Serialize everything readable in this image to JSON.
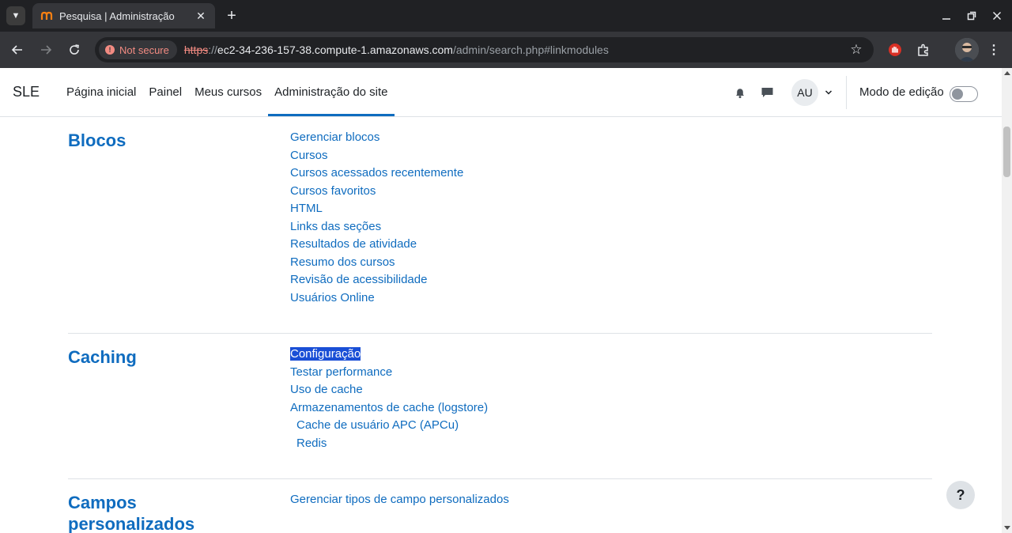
{
  "browser": {
    "tab_title": "Pesquisa | Administração",
    "security_label": "Not secure",
    "url_scheme": "https",
    "url_sep": "://",
    "url_host": "ec2-34-236-157-38.compute-1.amazonaws.com",
    "url_path": "/admin/search.php#linkmodules"
  },
  "navbar": {
    "brand": "SLE",
    "items": [
      "Página inicial",
      "Painel",
      "Meus cursos",
      "Administração do site"
    ],
    "active_item": "Administração do site",
    "avatar_initials": "AU",
    "edit_mode_label": "Modo de edição",
    "edit_mode_on": false
  },
  "sections": [
    {
      "title": "Blocos",
      "links": [
        "Gerenciar blocos",
        "Cursos",
        "Cursos acessados recentemente",
        "Cursos favoritos",
        "HTML",
        "Links das seções",
        "Resultados de atividade",
        "Resumo dos cursos",
        "Revisão de acessibilidade",
        "Usuários Online"
      ]
    },
    {
      "title": "Caching",
      "links": [
        "Configuração",
        "Testar performance",
        "Uso de cache",
        "Armazenamentos de cache (logstore)"
      ],
      "sub_links": [
        "Cache de usuário APC (APCu)",
        "Redis"
      ],
      "selected_link": "Configuração"
    },
    {
      "title_lines": [
        "Campos",
        "personalizados"
      ],
      "links": [
        "Gerenciar tipos de campo personalizados"
      ]
    }
  ],
  "help_button": "?",
  "colors": {
    "link": "#0f6cbf",
    "chrome_dark": "#202124",
    "chrome_toolbar": "#35363a",
    "not_secure": "#f28b82",
    "selection": "#1a4fd6"
  }
}
